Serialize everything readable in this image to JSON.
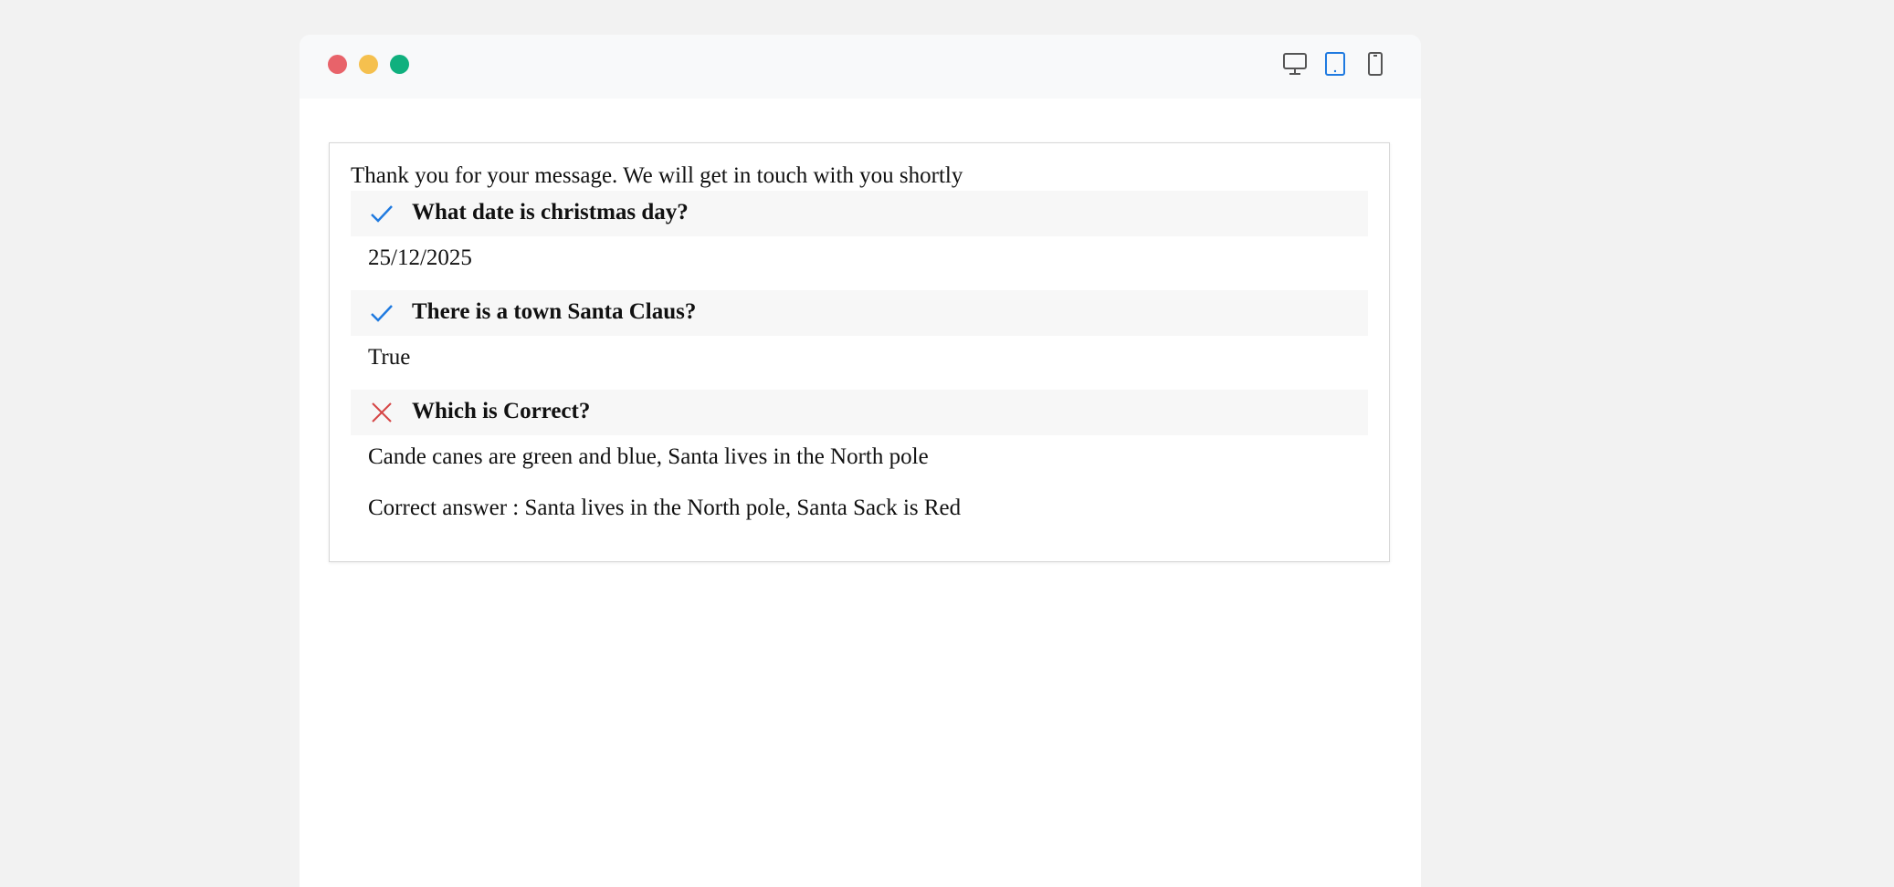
{
  "window": {
    "device_icons": [
      {
        "icon": "desktop-icon",
        "active": false
      },
      {
        "icon": "tablet-icon",
        "active": true
      },
      {
        "icon": "mobile-icon",
        "active": false
      }
    ]
  },
  "form": {
    "intro_text": "Thank you for your message. We will get in touch with you shortly",
    "questions": [
      {
        "title": "What date is christmas day?",
        "status": "correct",
        "status_icon": "check-icon",
        "answer": "25/12/2025"
      },
      {
        "title": "There is a town Santa Claus?",
        "status": "correct",
        "status_icon": "check-icon",
        "answer": "True"
      },
      {
        "title": "Which is Correct?",
        "status": "incorrect",
        "status_icon": "cross-icon",
        "answer": "Cande canes are green and blue, Santa lives in the North pole",
        "correct_answer": "Correct answer : Santa lives in the North pole, Santa Sack is Red"
      }
    ]
  },
  "colors": {
    "correct": "#1f7ae0",
    "incorrect": "#d64545",
    "active_device": "#1f7ae0",
    "inactive_device": "#555555"
  }
}
